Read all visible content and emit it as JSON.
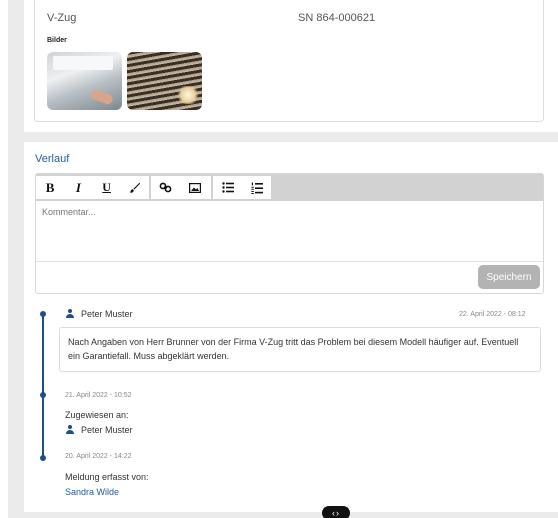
{
  "device": {
    "name": "V-Zug",
    "serial": "SN 864-000621",
    "images_label": "Bilder"
  },
  "history": {
    "title": "Verlauf",
    "toolbar": {
      "bold": "B",
      "italic": "I",
      "underline": "U"
    },
    "comment_placeholder": "Kommentar...",
    "save_label": "Speichern"
  },
  "timeline": {
    "entry1": {
      "user": "Peter Muster",
      "date": "22. April 2022 - 08:12",
      "comment": "Nach Angaben von Herr Brunner von der Firma V-Zug tritt das Problem bei diesem Modell häufiger auf. Eventuell ein Garantiefall. Muss abgeklärt werden."
    },
    "entry2": {
      "date": "21. April 2022 - 10:52",
      "label": "Zugewiesen an:",
      "user": "Peter Muster"
    },
    "entry3": {
      "date": "20. April 2022 - 14:22",
      "label": "Meldung erfasst von:",
      "user": "Sandra Wilde"
    }
  },
  "colors": {
    "accent": "#1e5aa8",
    "timeline": "#1f4e8c",
    "save_button": "#b3b3b3"
  }
}
